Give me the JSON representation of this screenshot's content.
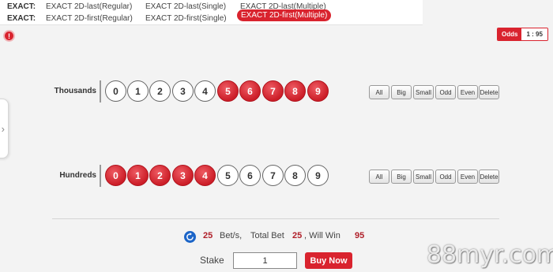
{
  "bet_types": {
    "row1": {
      "label": "EXACT:",
      "options": [
        "EXACT 2D-last(Regular)",
        "EXACT 2D-last(Single)",
        "EXACT 2D-last(Multiple)"
      ]
    },
    "row2": {
      "label": "EXACT:",
      "options": [
        "EXACT 2D-first(Regular)",
        "EXACT 2D-first(Single)",
        "EXACT 2D-first(Multiple)"
      ],
      "active_index": 2
    }
  },
  "info_icon": "exclamation-icon",
  "info_glyph": "!",
  "side_tab_glyph": "›",
  "odds": {
    "label": "Odds",
    "value": "1 : 95"
  },
  "digit_rows": [
    {
      "label": "Thousands",
      "digits": [
        "0",
        "1",
        "2",
        "3",
        "4",
        "5",
        "6",
        "7",
        "8",
        "9"
      ],
      "selected": [
        "5",
        "6",
        "7",
        "8",
        "9"
      ]
    },
    {
      "label": "Hundreds",
      "digits": [
        "0",
        "1",
        "2",
        "3",
        "4",
        "5",
        "6",
        "7",
        "8",
        "9"
      ],
      "selected": [
        "0",
        "1",
        "2",
        "3",
        "4"
      ]
    }
  ],
  "quick_buttons": [
    "All",
    "Big",
    "Small",
    "Odd",
    "Even",
    "Delete"
  ],
  "summary": {
    "bets": "25",
    "bets_label": "Bet/s,",
    "total_label": "Total Bet",
    "total": "25",
    "win_label": ", Will Win",
    "win": "95"
  },
  "stake": {
    "label": "Stake",
    "value": "1"
  },
  "buy_label": "Buy Now",
  "watermark": "88myr.com",
  "colors": {
    "accent": "#d9232e",
    "refresh": "#1c65c8"
  }
}
